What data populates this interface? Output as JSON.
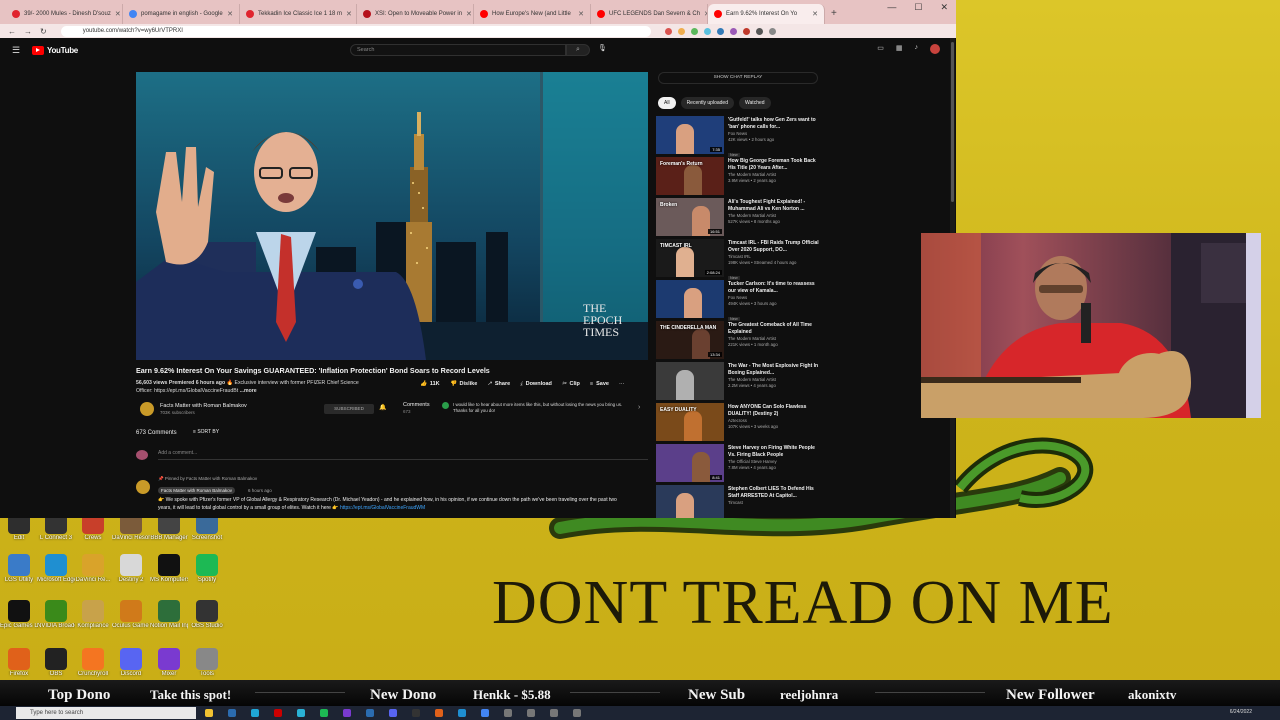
{
  "browser": {
    "tabs": [
      {
        "title": "39/- 2000 Mules - Dinesh D'souz",
        "color": "#e0242e"
      },
      {
        "title": "pomagame in english - Google",
        "color": "#4285f4"
      },
      {
        "title": "Tekkadin Ice Classic Ice 1 18 m",
        "color": "#e0242e"
      },
      {
        "title": "XSI: Open to Moveable Power in",
        "color": "#b5111b"
      },
      {
        "title": "How Europe's New (and Little",
        "color": "#ff0000"
      },
      {
        "title": "UFC LEGENDS Dan Severn & Ch",
        "color": "#ff0000"
      },
      {
        "title": "Earn 9.62% Interest On Yo",
        "color": "#ff0000",
        "active": true
      }
    ],
    "new_tab": "+",
    "controls": {
      "minimize": "—",
      "maximize": "☐",
      "close": "✕"
    },
    "url": "youtube.com/watch?v=wy6UrVTPRXI",
    "nav": {
      "back": "←",
      "forward": "→",
      "reload": "↻"
    }
  },
  "youtube": {
    "logo": "YouTube",
    "search_placeholder": "Search",
    "search_icon": "⌕",
    "mic_icon": "🎙",
    "video": {
      "watermark_line1": "THE",
      "watermark_line2": "EPOCH",
      "watermark_line3": "TIMES",
      "title": "Earn 9.62% Interest On Your Savings GUARANTEED: 'Inflation Protection' Bond Soars to Record Levels",
      "views": "56,603 views",
      "premiered": "Premiered 6 hours ago",
      "exclusive": "🔥 Exclusive interview with former PFIZER Chief Science",
      "officer": "Officer:",
      "officer_link": "https://ept.ms/GlobalVaccineFraudBt",
      "more": "...more",
      "actions": {
        "like": "11K",
        "dislike": "Dislike",
        "share": "Share",
        "download": "Download",
        "clip": "Clip",
        "save": "Save",
        "more": "···"
      }
    },
    "channel": {
      "name": "Facts Matter with Roman Balmakov",
      "subs": "703K subscribers",
      "subscribe": "SUBSCRIBED",
      "bell": "🔔"
    },
    "comments_teaser": {
      "header": "Comments",
      "count": "673",
      "text": "I would like to hear about more items like this, but without losing the news you bring us. Thanks for all you do!",
      "chevron": "›"
    },
    "comments": {
      "count": "673 Comments",
      "sort": "SORT BY",
      "add_placeholder": "Add a comment...",
      "pinned": "Pinned by Facts Matter with Roman Balmakov",
      "author": "Facts Matter with Roman Balmakov",
      "time": "6 hours ago",
      "body": "👉 We spoke with Pfizer's former VP of Global Allergy & Respiratory Research (Dr. Michael Yeadon) - and he explained how, in his opinion, if we continue down the path we've been traveling over the past two years, it will lead to total global control by a small group of elites. Watch it here 👉",
      "body_link": "https://ept.ms/GlobalVaccineFraudWM"
    },
    "sidebar": {
      "chat_replay": "SHOW CHAT REPLAY",
      "chips": [
        "All",
        "Recently uploaded",
        "Watched"
      ],
      "items": [
        {
          "title": "'Gutfeld!' talks how Gen Zers want to 'ban' phone calls for...",
          "channel": "Fox News",
          "views": "42K views • 2 hours ago",
          "badge": "New",
          "duration": "7:35",
          "thumb_bg": "#1f3e7a",
          "thumb_text": ""
        },
        {
          "title": "How Big George Foreman Took Back His Title (20 Years After...",
          "channel": "The Modern Martial Artist",
          "views": "3.9M views • 2 years ago",
          "badge": "",
          "duration": "",
          "thumb_bg": "#5a2018",
          "thumb_text": "Foreman's Return"
        },
        {
          "title": "Ali's Toughest Fight Explained! - Muhammad Ali vs Ken Norton ...",
          "channel": "The Modern Martial Artist",
          "views": "527K views • 8 months ago",
          "badge": "",
          "duration": "16:51",
          "thumb_bg": "#6b5a5a",
          "thumb_text": "Broken"
        },
        {
          "title": "Timcast IRL - FBI Raids Trump Official Over 2020 Support, DO...",
          "channel": "Timcast IRL",
          "views": "198K views • Streamed 4 hours ago",
          "badge": "New",
          "duration": "2:08:24",
          "thumb_bg": "#1a1a1a",
          "thumb_text": "TIMCAST IRL"
        },
        {
          "title": "Tucker Carlson: It's time to reassess our view of Kamala...",
          "channel": "Fox News",
          "views": "494K views • 3 hours ago",
          "badge": "New",
          "duration": "",
          "thumb_bg": "#1c3a70",
          "thumb_text": ""
        },
        {
          "title": "The Greatest Comeback of All Time Explained",
          "channel": "The Modern Martial Artist",
          "views": "221K views • 1 month ago",
          "badge": "",
          "duration": "13:34",
          "thumb_bg": "#2a1a14",
          "thumb_text": "THE CINDERELLA MAN"
        },
        {
          "title": "The War - The Most Explosive Fight In Boxing Explained...",
          "channel": "The Modern Martial Artist",
          "views": "2.2M views • 4 years ago",
          "badge": "",
          "duration": "",
          "thumb_bg": "#3a3a3a",
          "thumb_text": ""
        },
        {
          "title": "How ANYONE Can Solo Flawless DUALITY! (Destiny 2)",
          "channel": "Aztecross",
          "views": "107K views • 3 weeks ago",
          "badge": "",
          "duration": "",
          "thumb_bg": "#7a4a1a",
          "thumb_text": "EASY DUALITY"
        },
        {
          "title": "Steve Harvey on Firing White People Vs. Firing Black People",
          "channel": "The Official Steve Harvey",
          "views": "7.8M views • 4 years ago",
          "badge": "",
          "duration": "8:41",
          "thumb_bg": "#5b3f8a",
          "thumb_text": ""
        },
        {
          "title": "Stephen Colbert LIES To Defend His Staff ARRESTED At Capitol...",
          "channel": "Timcast",
          "views": "",
          "badge": "",
          "duration": "",
          "thumb_bg": "#2a3a5a",
          "thumb_text": ""
        }
      ]
    }
  },
  "desktop": {
    "motto": "DONT TREAD ON ME",
    "icons": [
      {
        "label": "Edit",
        "color": "#2e2e2e"
      },
      {
        "label": "L Connect 3",
        "color": "#333"
      },
      {
        "label": "Crews",
        "color": "#c83f2a"
      },
      {
        "label": "DaVinci Resolve",
        "color": "#7b5b3a"
      },
      {
        "label": "BBB Manager",
        "color": "#444"
      },
      {
        "label": "Screenshot",
        "color": "#3a6a9a"
      },
      {
        "label": "LGS Utility",
        "color": "#3a7bc8"
      },
      {
        "label": "Microsoft Edge",
        "color": "#1f8fd1"
      },
      {
        "label": "DaVinci Re...",
        "color": "#d9a32a"
      },
      {
        "label": "Destiny 2",
        "color": "#d8d8d8"
      },
      {
        "label": "MS Komputers",
        "color": "#111"
      },
      {
        "label": "Spotify",
        "color": "#1db954"
      },
      {
        "label": "Epic Games Launcher",
        "color": "#111"
      },
      {
        "label": "NVIDIA Broadcast",
        "color": "#3a8a1a"
      },
      {
        "label": "Kompliance",
        "color": "#c8a24a"
      },
      {
        "label": "Oculus Game Manager",
        "color": "#d07a1a"
      },
      {
        "label": "Notion Mail Input",
        "color": "#2d6e3a"
      },
      {
        "label": "OBS Studio",
        "color": "#333"
      },
      {
        "label": "Firefox",
        "color": "#e0611a"
      },
      {
        "label": "OBS",
        "color": "#222"
      },
      {
        "label": "Crunchyroll",
        "color": "#f47521"
      },
      {
        "label": "Discord",
        "color": "#5865f2"
      },
      {
        "label": "Mixer",
        "color": "#7a3ad0"
      },
      {
        "label": "Tools",
        "color": "#888"
      }
    ]
  },
  "overlay": {
    "top_dono_label": "Top Dono",
    "top_dono_value": "Take this spot!",
    "new_dono_label": "New Dono",
    "new_dono_value": "Henkk - $5.88",
    "new_sub_label": "New Sub",
    "new_sub_value": "reeljohnra",
    "new_follower_label": "New Follower",
    "new_follower_value": "akonixtv"
  },
  "taskbar": {
    "search_placeholder": "Type here to search",
    "clock": "6/24/2022",
    "apps": [
      "#f1c232",
      "#2b6cb0",
      "#1fa7d6",
      "#cc0000",
      "#2ab2d6",
      "#1db954",
      "#7a3ad0",
      "#2b6cb0",
      "#5865f2",
      "#333",
      "#e0611a",
      "#1f8fd1",
      "#4285f4",
      "#777",
      "#777",
      "#777",
      "#777"
    ]
  }
}
